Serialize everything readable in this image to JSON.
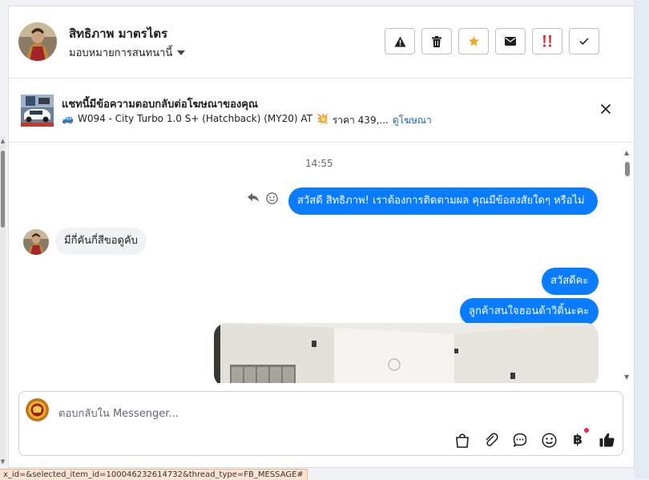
{
  "header": {
    "name": "สิทธิภาพ มาตรไตร",
    "assign_label": "มอบหมายการสนทนานี้",
    "actions": [
      "warning-icon",
      "trash-icon",
      "star-icon",
      "mail-icon",
      "important-icon",
      "check-icon"
    ]
  },
  "ad": {
    "title": "แชทนี้มีข้อความตอบกลับต่อโฆษณาของคุณ",
    "emoji_car": "🚙",
    "detail": "W094 - City Turbo 1.0 S+ (Hatchback) (MY20) AT",
    "emoji_burst": "💥",
    "price": "ราคา 439,...",
    "link": "ดูโฆษณา"
  },
  "messages": {
    "time": "14:55",
    "out1": "สวัสดี สิทธิภาพ! เราต้องการติดตามผล คุณมีข้อสงสัยใดๆ หรือไม่",
    "in1": "มีกี่คันกี่สีขอดูคับ",
    "out2": "สวัสดีคะ",
    "out3": "ลูกค้าสนใจฮอนด้าวิติ้นะคะ"
  },
  "composer": {
    "placeholder": "ตอบกลับใน Messenger...",
    "baht_symbol": "฿"
  },
  "status_bar": {
    "url": "x_id=&selected_item_id=100046232614732&thread_type=FB_MESSAGE#"
  },
  "colors": {
    "accent": "#0a7cff",
    "star": "#f5a623",
    "important": "#e4292f",
    "link": "#1b5fb8"
  }
}
